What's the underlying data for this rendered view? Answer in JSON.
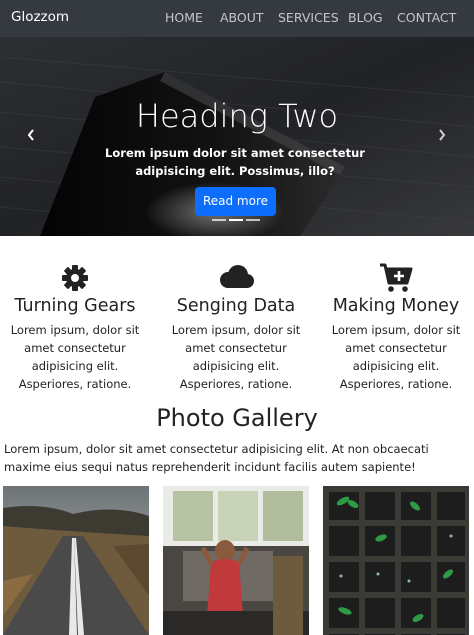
{
  "navbar": {
    "brand": "Glozzom",
    "links": [
      "HOME",
      "ABOUT",
      "SERVICES",
      "BLOG",
      "CONTACT"
    ]
  },
  "hero": {
    "title": "Heading Two",
    "text": "Lorem ipsum dolor sit amet consectetur adipisicing elit. Possimus, illo?",
    "button": "Read more",
    "slides": 3,
    "active_slide": 2
  },
  "features": [
    {
      "icon": "gear-icon",
      "title": "Turning Gears",
      "text": "Lorem ipsum, dolor sit amet consectetur adipisicing elit. Asperiores, ratione."
    },
    {
      "icon": "cloud-icon",
      "title": "Senging Data",
      "text": "Lorem ipsum, dolor sit amet consectetur adipisicing elit. Asperiores, ratione."
    },
    {
      "icon": "cart-plus-icon",
      "title": "Making Money",
      "text": "Lorem ipsum, dolor sit amet consectetur adipisicing elit. Asperiores, ratione."
    }
  ],
  "gallery": {
    "title": "Photo Gallery",
    "text": "Lorem ipsum, dolor sit amet consectetur adipisicing elit. At non obcaecati maxime eius sequi natus reprehenderit incidunt facilis autem sapiente!"
  },
  "colors": {
    "navbar": "#343a40",
    "primary": "#0d6efd",
    "icon": "#222222"
  }
}
